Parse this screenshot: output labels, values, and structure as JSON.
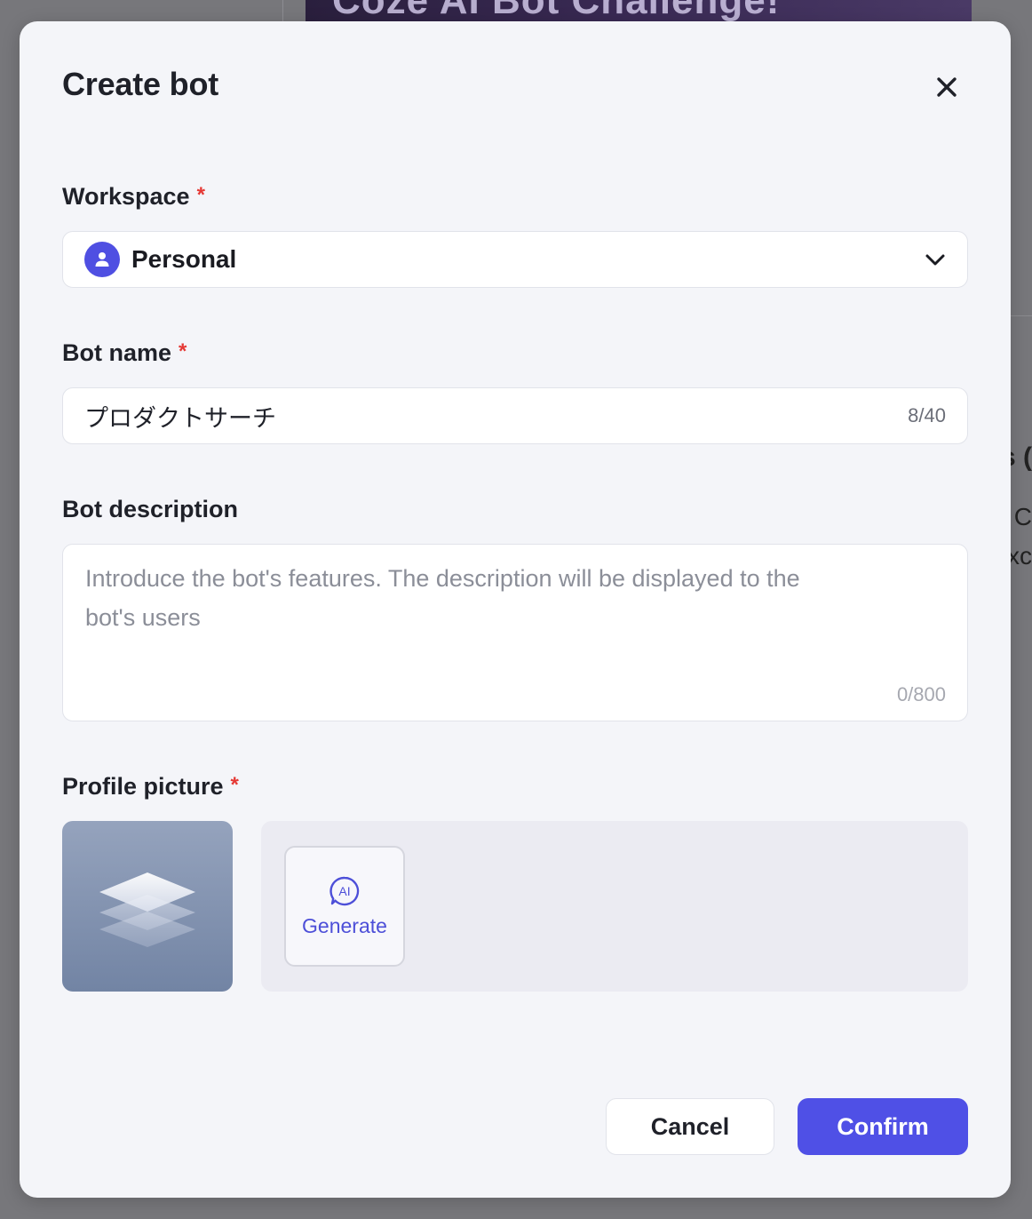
{
  "background": {
    "banner_text": "Coze AI Bot Challenge!",
    "right_fragments": [
      "s (",
      "C",
      "xc"
    ]
  },
  "modal": {
    "title": "Create bot",
    "close_icon": "close-icon"
  },
  "workspace": {
    "label": "Workspace",
    "required_mark": "*",
    "selected_value": "Personal",
    "icon": "user-icon"
  },
  "bot_name": {
    "label": "Bot name",
    "required_mark": "*",
    "value": "プロダクトサーチ",
    "counter": "8/40"
  },
  "bot_description": {
    "label": "Bot description",
    "placeholder": "Introduce the bot's features. The description will be displayed to the bot's users",
    "counter": "0/800"
  },
  "profile_picture": {
    "label": "Profile picture",
    "required_mark": "*",
    "generate_label": "Generate",
    "generate_icon": "ai-chat-icon"
  },
  "actions": {
    "cancel_label": "Cancel",
    "confirm_label": "Confirm"
  },
  "colors": {
    "accent": "#4f50e6",
    "required": "#e53935"
  }
}
